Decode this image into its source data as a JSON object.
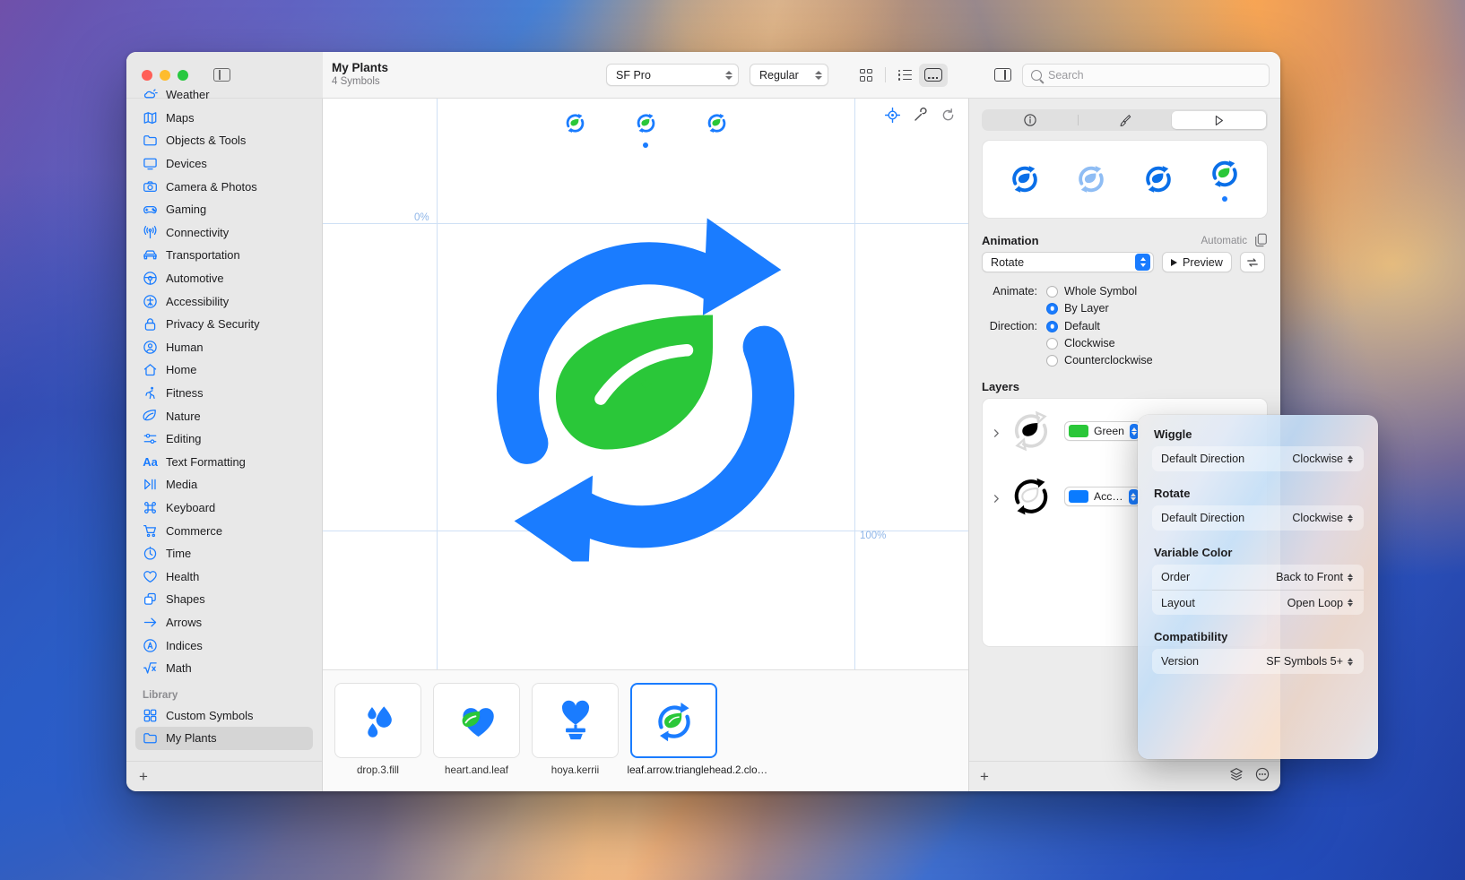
{
  "app": {
    "document_title": "My Plants",
    "document_subtitle": "4 Symbols"
  },
  "toolbar": {
    "font_popup": "SF Pro",
    "weight_popup": "Regular",
    "view_modes": [
      "grid-view",
      "list-view",
      "gallery-view"
    ],
    "active_view_mode": "gallery-view",
    "search_placeholder": "Search"
  },
  "sidebar": {
    "items": [
      {
        "label": "Weather",
        "icon": "weather-icon"
      },
      {
        "label": "Maps",
        "icon": "map-icon"
      },
      {
        "label": "Objects & Tools",
        "icon": "folder-icon"
      },
      {
        "label": "Devices",
        "icon": "display-icon"
      },
      {
        "label": "Camera & Photos",
        "icon": "camera-icon"
      },
      {
        "label": "Gaming",
        "icon": "gamecontroller-icon"
      },
      {
        "label": "Connectivity",
        "icon": "antenna-icon"
      },
      {
        "label": "Transportation",
        "icon": "car-icon"
      },
      {
        "label": "Automotive",
        "icon": "steeringwheel-icon"
      },
      {
        "label": "Accessibility",
        "icon": "accessibility-icon"
      },
      {
        "label": "Privacy & Security",
        "icon": "lock-icon"
      },
      {
        "label": "Human",
        "icon": "person-icon"
      },
      {
        "label": "Home",
        "icon": "house-icon"
      },
      {
        "label": "Fitness",
        "icon": "figure-run-icon"
      },
      {
        "label": "Nature",
        "icon": "leaf-icon"
      },
      {
        "label": "Editing",
        "icon": "sliders-icon"
      },
      {
        "label": "Text Formatting",
        "icon": "textformat-icon"
      },
      {
        "label": "Media",
        "icon": "playpause-icon"
      },
      {
        "label": "Keyboard",
        "icon": "command-icon"
      },
      {
        "label": "Commerce",
        "icon": "cart-icon"
      },
      {
        "label": "Time",
        "icon": "timer-icon"
      },
      {
        "label": "Health",
        "icon": "heart-icon"
      },
      {
        "label": "Shapes",
        "icon": "shapes-icon"
      },
      {
        "label": "Arrows",
        "icon": "arrow-right-icon"
      },
      {
        "label": "Indices",
        "icon": "circle-a-icon"
      },
      {
        "label": "Math",
        "icon": "sqrt-icon"
      }
    ],
    "group_label": "Library",
    "library_items": [
      {
        "label": "Custom Symbols",
        "icon": "custom-symbols-icon",
        "selected": false
      },
      {
        "label": "My Plants",
        "icon": "folder-icon",
        "selected": true
      }
    ],
    "add_button": "+"
  },
  "canvas": {
    "guide_labels": [
      "0%",
      "100%"
    ],
    "tools": [
      "align-icon",
      "wrench-icon",
      "refresh-icon"
    ],
    "mini_previews": 3,
    "symbol_colors": {
      "blue": "#1a7cff",
      "green": "#2ac739"
    }
  },
  "filmstrip": {
    "items": [
      {
        "name": "drop.3.fill",
        "icon": "drop-3-fill-icon",
        "selected": false
      },
      {
        "name": "heart.and.leaf",
        "icon": "heart-and-leaf-icon",
        "selected": false
      },
      {
        "name": "hoya.kerrii",
        "icon": "hoya-kerrii-icon",
        "selected": false
      },
      {
        "name": "leaf.arrow.trianglehead.2.clo…",
        "icon": "leaf-arrow-icon",
        "selected": true
      }
    ]
  },
  "inspector": {
    "tabs": [
      "info-tab",
      "appearance-tab",
      "animation-tab"
    ],
    "active_tab": "animation-tab",
    "animation": {
      "section_title": "Animation",
      "automatic_label": "Automatic",
      "type_value": "Rotate",
      "preview_button": "Preview",
      "animate_label": "Animate:",
      "animate_options": [
        {
          "label": "Whole Symbol",
          "selected": false
        },
        {
          "label": "By Layer",
          "selected": true
        }
      ],
      "direction_label": "Direction:",
      "direction_options": [
        {
          "label": "Default",
          "selected": true
        },
        {
          "label": "Clockwise",
          "selected": false
        },
        {
          "label": "Counterclockwise",
          "selected": false
        }
      ]
    },
    "layers": {
      "section_title": "Layers",
      "rows": [
        {
          "color_name": "Green",
          "color_hex": "#2ac739"
        },
        {
          "color_name": "Acc…",
          "color_hex": "#0a7bff"
        }
      ]
    },
    "footer": {
      "add": "+",
      "icons": [
        "layers-icon",
        "more-icon"
      ]
    }
  },
  "popover": {
    "sections": [
      {
        "title": "Wiggle",
        "rows": [
          {
            "label": "Default Direction",
            "value": "Clockwise"
          }
        ]
      },
      {
        "title": "Rotate",
        "rows": [
          {
            "label": "Default Direction",
            "value": "Clockwise"
          }
        ]
      },
      {
        "title": "Variable Color",
        "rows": [
          {
            "label": "Order",
            "value": "Back to Front"
          },
          {
            "label": "Layout",
            "value": "Open Loop"
          }
        ]
      },
      {
        "title": "Compatibility",
        "rows": [
          {
            "label": "Version",
            "value": "SF Symbols 5+"
          }
        ]
      }
    ]
  }
}
